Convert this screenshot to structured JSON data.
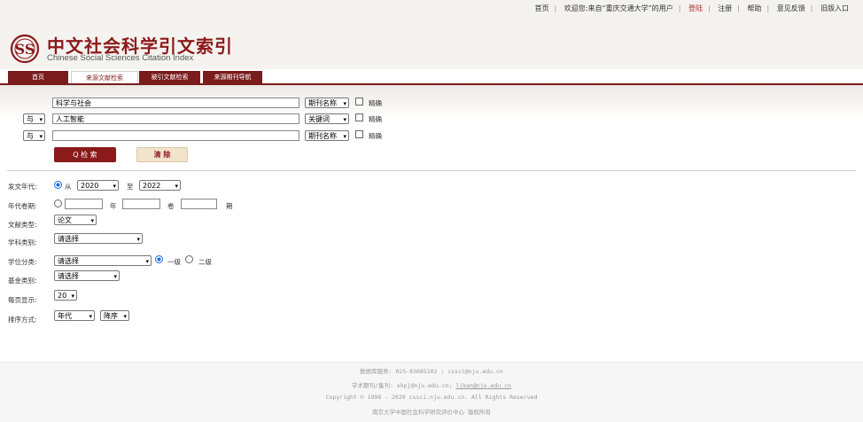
{
  "topnav": {
    "home": "首页",
    "welcome": "欢迎您:来自“重庆交通大学”的用户",
    "login": "登陆",
    "register": "注册",
    "help": "帮助",
    "feedback": "意见反馈",
    "old_version": "旧版入口"
  },
  "brand": {
    "title_zh": "中文社会科学引文索引",
    "title_en": "Chinese Social Sciences Citation Index"
  },
  "tabs": [
    "首页",
    "来源文献检索",
    "被引文献检索",
    "来源期刊导航"
  ],
  "search": {
    "rows": [
      {
        "logic": "",
        "value": "科学与社会",
        "field": "期刊名称",
        "exact_label": "精确"
      },
      {
        "logic": "与",
        "value": "人工智能",
        "field": "关键词",
        "exact_label": "精确"
      },
      {
        "logic": "与",
        "value": "",
        "field": "期刊名称",
        "exact_label": "精确"
      }
    ],
    "search_button": "Q 检 索",
    "clear_button": "清 除"
  },
  "filters": {
    "year_label": "发文年代:",
    "year_from_label": "从",
    "year_from": "2020",
    "year_to_label": "至",
    "year_to": "2022",
    "volume_label": "年代卷期:",
    "year_unit": "年",
    "volume_unit": "卷",
    "issue_unit": "期",
    "doctype_label": "文献类型:",
    "doctype": "论文",
    "subject_label": "学科类别:",
    "subject": "请选择",
    "degree_label": "学位分类:",
    "degree": "请选择",
    "level1": "一级",
    "level2": "二级",
    "fund_label": "基金类别:",
    "fund": "请选择",
    "perpage_label": "每页显示:",
    "perpage": "20",
    "sort_label": "排序方式:",
    "sort_field": "年代",
    "sort_order": "降序"
  },
  "footer": {
    "line1": "数据库服务: 025-83685102 ; cssci@nju.edu.cn",
    "line2_prefix": "学术期刊/集刊: skpj@nju.edu.cn;",
    "line2_link": "ljkan@nju.edu.cn",
    "line3": "Copyright © 1998 - 2020 cssci.nju.edu.cn. All Rights Reserved",
    "line4": "南京大学中国社会科学研究评价中心 版权所有"
  },
  "colors": {
    "brand": "#8b1a1a",
    "radio": "#1a6ed8"
  }
}
